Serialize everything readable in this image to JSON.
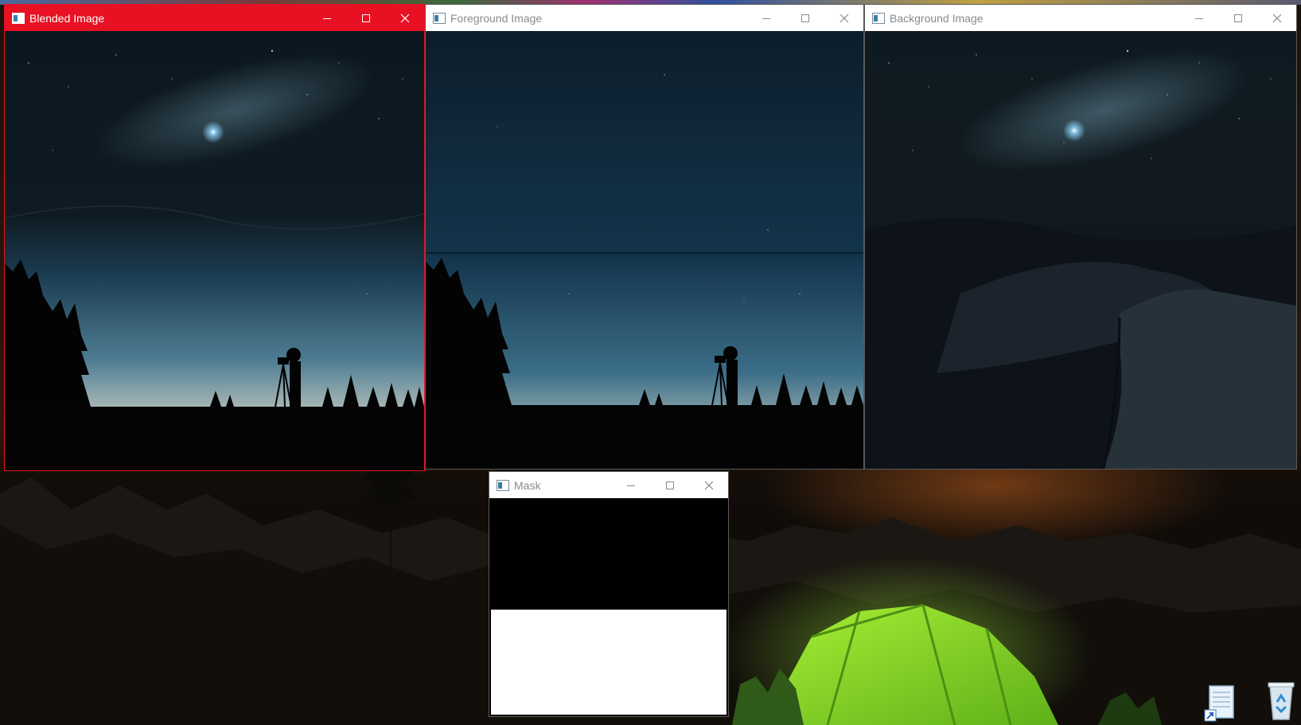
{
  "desktop": {
    "wallpaper": "night camping scene with glowing green tent",
    "icons": [
      {
        "name": "notepad-shortcut-icon"
      },
      {
        "name": "recycle-bin-icon"
      }
    ]
  },
  "windows": {
    "blended": {
      "title": "Blended Image",
      "active": true
    },
    "foreground": {
      "title": "Foreground Image",
      "active": false
    },
    "background": {
      "title": "Background Image",
      "active": false
    },
    "mask": {
      "title": "Mask",
      "active": false
    }
  },
  "colors": {
    "active_titlebar": "#e81123",
    "inactive_titlebar": "#ffffff",
    "tent_green": "#8ee02a",
    "night_sky": "#0d2233"
  }
}
